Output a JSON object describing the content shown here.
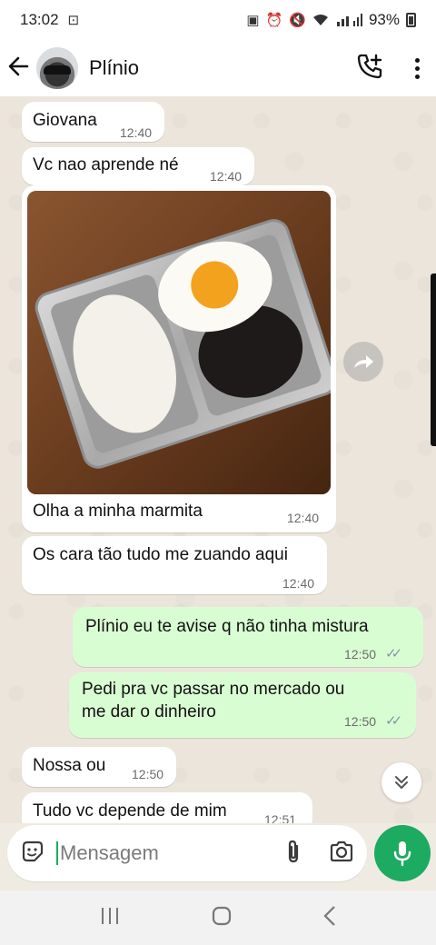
{
  "status_bar": {
    "time": "13:02",
    "battery": "93%"
  },
  "header": {
    "contact_name": "Plínio"
  },
  "messages": [
    {
      "direction": "in",
      "text": "Giovana",
      "time": "12:40"
    },
    {
      "direction": "in",
      "text": "Vc nao aprende né",
      "time": "12:40"
    },
    {
      "direction": "in",
      "type": "image",
      "caption": "Olha a minha marmita",
      "time": "12:40"
    },
    {
      "direction": "in",
      "text": "Os cara tão tudo me zuando aqui",
      "time": "12:40"
    },
    {
      "direction": "out",
      "text": "Plínio eu te avise q não tinha mistura",
      "time": "12:50",
      "status": "read"
    },
    {
      "direction": "out",
      "text_line1": "Pedi pra vc passar no mercado ou",
      "text_line2": "me dar o dinheiro",
      "time": "12:50",
      "status": "read"
    },
    {
      "direction": "in",
      "text": "Nossa ou",
      "time": "12:50"
    },
    {
      "direction": "in",
      "text": "Tudo vc depende de mim",
      "time": "12:51"
    }
  ],
  "composer": {
    "placeholder": "Mensagem"
  },
  "colors": {
    "accent": "#1daa61",
    "outgoing_bubble": "#d9fdd3",
    "incoming_bubble": "#ffffff",
    "read_ticks": "#8696a0"
  },
  "icons": [
    "back-arrow-icon",
    "add-call-icon",
    "more-options-icon",
    "forward-icon",
    "scroll-down-icon",
    "sticker-icon",
    "attach-icon",
    "camera-icon",
    "mic-icon",
    "recent-apps-icon",
    "home-icon",
    "back-nav-icon"
  ]
}
